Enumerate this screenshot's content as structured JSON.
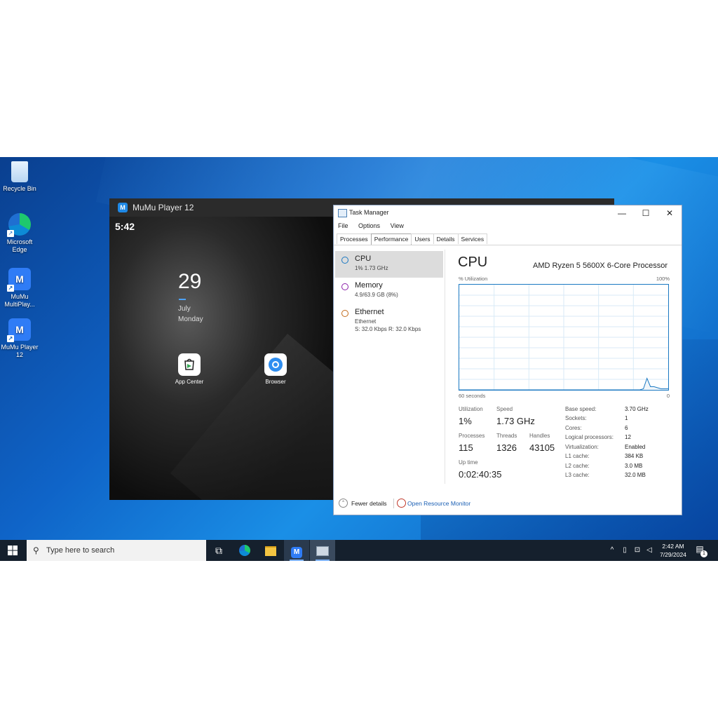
{
  "desktop": {
    "icons": [
      {
        "label": "Recycle Bin"
      },
      {
        "label": "Microsoft Edge"
      },
      {
        "label": "MuMu MultiPlay..."
      },
      {
        "label": "MuMu Player 12"
      }
    ]
  },
  "mumu": {
    "title": "MuMu Player 12",
    "status_time": "5:42",
    "date_number": "29",
    "month": "July",
    "weekday": "Monday",
    "apps": [
      {
        "label": "App Center",
        "icon": "play-store-icon"
      },
      {
        "label": "Browser",
        "icon": "browser-icon"
      }
    ]
  },
  "taskmanager": {
    "title": "Task Manager",
    "menu": [
      "File",
      "Options",
      "View"
    ],
    "tabs": [
      "Processes",
      "Performance",
      "Users",
      "Details",
      "Services"
    ],
    "active_tab": "Performance",
    "sidebar": [
      {
        "name": "CPU",
        "line1": "1% 1.73 GHz",
        "line2": "",
        "color": "#1a78c2"
      },
      {
        "name": "Memory",
        "line1": "4.9/63.9 GB (8%)",
        "line2": "",
        "color": "#8b1fa9"
      },
      {
        "name": "Ethernet",
        "line1": "Ethernet",
        "line2": "S: 32.0 Kbps R: 32.0 Kbps",
        "color": "#c26a1a"
      }
    ],
    "cpu": {
      "heading": "CPU",
      "model": "AMD Ryzen 5 5600X 6-Core Processor",
      "util_label": "% Utilization",
      "max_label": "100%",
      "time_label": "60 seconds",
      "min_label": "0",
      "utilization_history_percent": [
        0,
        0,
        0,
        0,
        0,
        0,
        0,
        0,
        0,
        0,
        0,
        0,
        0,
        0,
        0,
        0,
        0,
        0,
        0,
        0,
        0,
        0,
        0,
        0,
        0,
        0,
        0,
        0,
        0,
        0,
        0,
        0,
        0,
        0,
        0,
        0,
        0,
        0,
        0,
        0,
        0,
        0,
        0,
        0,
        0,
        0,
        0,
        0,
        0,
        0,
        0,
        0,
        1,
        11,
        3,
        3,
        2,
        1,
        1,
        1
      ],
      "stats": {
        "utilization_label": "Utilization",
        "utilization": "1%",
        "speed_label": "Speed",
        "speed": "1.73 GHz",
        "processes_label": "Processes",
        "processes": "115",
        "threads_label": "Threads",
        "threads": "1326",
        "handles_label": "Handles",
        "handles": "43105",
        "uptime_label": "Up time",
        "uptime": "0:02:40:35"
      },
      "specs": [
        {
          "k": "Base speed:",
          "v": "3.70 GHz"
        },
        {
          "k": "Sockets:",
          "v": "1"
        },
        {
          "k": "Cores:",
          "v": "6"
        },
        {
          "k": "Logical processors:",
          "v": "12"
        },
        {
          "k": "Virtualization:",
          "v": "Enabled"
        },
        {
          "k": "L1 cache:",
          "v": "384 KB"
        },
        {
          "k": "L2 cache:",
          "v": "3.0 MB"
        },
        {
          "k": "L3 cache:",
          "v": "32.0 MB"
        }
      ]
    },
    "footer": {
      "fewer": "Fewer details",
      "monitor": "Open Resource Monitor"
    }
  },
  "taskbar": {
    "search_placeholder": "Type here to search",
    "time": "2:42 AM",
    "date": "7/29/2024",
    "notification_count": "1"
  }
}
